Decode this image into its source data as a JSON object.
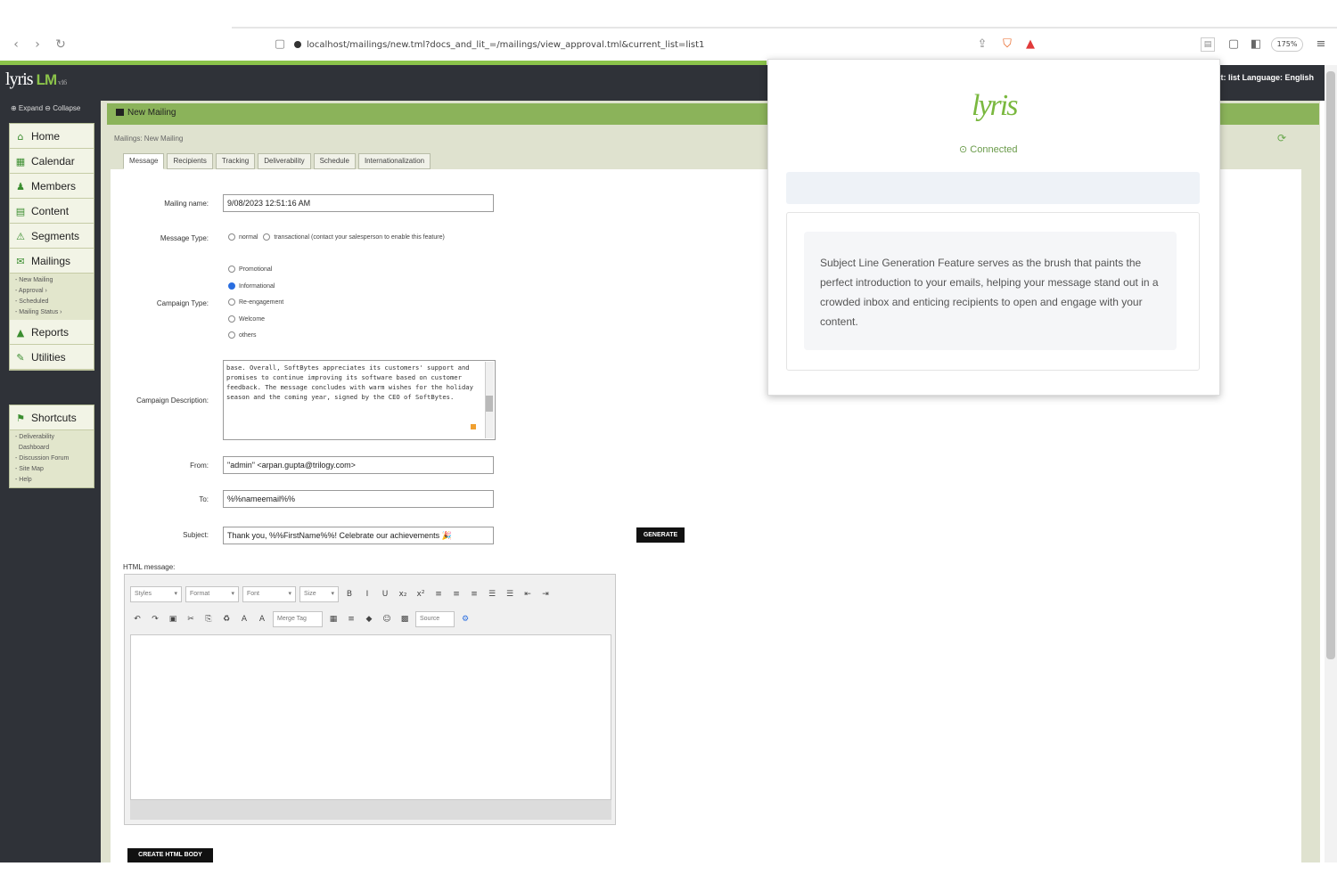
{
  "browser": {
    "url": "localhost/mailings/new.tml?docs_and_lit_=/mailings/view_approval.tml&current_list=list1",
    "nav_back": "‹",
    "nav_forward": "›",
    "nav_reload": "↻",
    "zoom": "175%"
  },
  "app": {
    "logo": "lyris",
    "logo_lm": "LM",
    "logo_version": "v16",
    "header_right": "List: list   Language: English",
    "expand_collapse": "⊕ Expand  ⊖ Collapse"
  },
  "sidebar": {
    "items": [
      {
        "label": "Home",
        "icon": "home-icon",
        "glyph": "⌂"
      },
      {
        "label": "Calendar",
        "icon": "calendar-icon",
        "glyph": "▦"
      },
      {
        "label": "Members",
        "icon": "members-icon",
        "glyph": "♟"
      },
      {
        "label": "Content",
        "icon": "content-icon",
        "glyph": "▤"
      },
      {
        "label": "Segments",
        "icon": "segments-icon",
        "glyph": "⚠"
      },
      {
        "label": "Mailings",
        "icon": "mailings-icon",
        "glyph": "✉"
      }
    ],
    "mailings_sub": [
      "- New Mailing",
      "- Approval   ›",
      "- Scheduled",
      "- Mailing Status  ›"
    ],
    "items2": [
      {
        "label": "Reports",
        "icon": "reports-icon",
        "glyph": "▲"
      },
      {
        "label": "Utilities",
        "icon": "utilities-icon",
        "glyph": "✎"
      }
    ],
    "shortcuts": {
      "label": "Shortcuts",
      "icon": "shortcuts-icon",
      "glyph": "⚑"
    },
    "shortcut_sub": [
      "- Deliverability",
      "  Dashboard",
      "- Discussion Forum",
      "- Site Map",
      "- Help"
    ]
  },
  "panel": {
    "title": "New Mailing",
    "breadcrumb": "Mailings: New Mailing",
    "tabs": [
      "Message",
      "Recipients",
      "Tracking",
      "Deliverability",
      "Schedule",
      "Internationalization"
    ]
  },
  "form": {
    "mailing_name_label": "Mailing name:",
    "mailing_name_value": "9/08/2023 12:51:16 AM",
    "message_type_label": "Message Type:",
    "message_type_options": [
      "normal",
      "transactional  (contact your salesperson to enable this feature)"
    ],
    "campaign_type_label": "Campaign Type:",
    "campaign_type_options": [
      "Promotional",
      "Informational",
      "Re-engagement",
      "Welcome",
      "others"
    ],
    "campaign_type_selected": 1,
    "campaign_desc_label": "Campaign Description:",
    "campaign_desc_value": "base. Overall, SoftBytes appreciates its customers' support and promises to continue improving its software based on customer feedback. The message concludes with warm wishes for the holiday season and the coming year, signed by the CEO of SoftBytes.",
    "from_label": "From:",
    "from_value": "\"admin\" <arpan.gupta@trilogy.com>",
    "to_label": "To:",
    "to_value": "%%nameemail%%",
    "subject_label": "Subject:",
    "subject_value": "Thank you, %%FirstName%%! Celebrate our achievements 🎉",
    "ai_button": "GENERATE",
    "html_message_label": "HTML message:",
    "bottom_button": "CREATE HTML BODY"
  },
  "editor": {
    "dropdowns": [
      "Styles",
      "Format",
      "Font",
      "Size"
    ],
    "row1_buttons": [
      "B",
      "I",
      "U",
      "x₂",
      "x²",
      "≡",
      "≡",
      "≡",
      "☰",
      "☰",
      "⇤",
      "⇥"
    ],
    "row2_buttons": [
      "↶",
      "↷",
      "▣",
      "✂",
      "⎘",
      "♻",
      "A",
      "A"
    ],
    "merge_tag": "Merge Tag",
    "row2_more": [
      "▦",
      "≡",
      "◆",
      "☺",
      "▩"
    ],
    "source": "Source",
    "gear": "⚙"
  },
  "popup": {
    "logo": "lyris",
    "status": "Connected",
    "status_icon": "⊙",
    "description": "Subject Line Generation Feature serves as the brush that paints the perfect introduction to your emails, helping your message stand out in a crowded inbox and enticing recipients to open and engage with your content."
  },
  "colors": {
    "accent": "#8bc34a",
    "header": "#2f3238",
    "panel_title": "#8bb35a"
  }
}
